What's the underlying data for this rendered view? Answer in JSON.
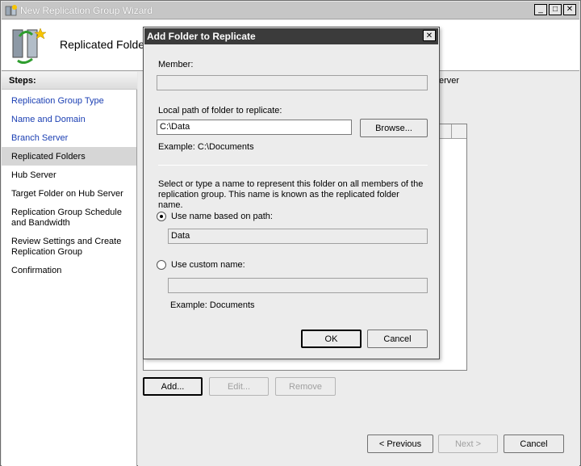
{
  "window": {
    "title": "New Replication Group Wizard",
    "controls": {
      "minimize": "_",
      "maximize": "□",
      "close": "✕"
    }
  },
  "header": {
    "title": "Replicated Folders"
  },
  "sidebar": {
    "heading": "Steps:",
    "items": [
      {
        "label": "Replication Group Type"
      },
      {
        "label": "Name and Domain"
      },
      {
        "label": "Branch Server"
      },
      {
        "label": "Replicated Folders"
      },
      {
        "label": "Hub Server"
      },
      {
        "label": "Target Folder on Hub Server"
      },
      {
        "label": "Replication Group Schedule and Bandwidth"
      },
      {
        "label": "Review Settings and Create Replication Group"
      },
      {
        "label": "Confirmation"
      }
    ]
  },
  "main": {
    "partial_text": "erver",
    "buttons": {
      "add": "Add...",
      "edit": "Edit...",
      "remove": "Remove"
    }
  },
  "footer": {
    "previous": "< Previous",
    "next": "Next >",
    "cancel": "Cancel"
  },
  "dialog": {
    "title": "Add Folder to Replicate",
    "close": "✕",
    "member_label": "Member:",
    "member_value": "",
    "local_path_label": "Local path of folder to replicate:",
    "local_path_value": "C:\\Data",
    "browse": "Browse...",
    "example_path": "Example: C:\\Documents",
    "description": "Select or type a name to represent this folder on all members of the replication group. This name is known as the replicated folder name.",
    "option_path": "Use name based on path:",
    "path_name_value": "Data",
    "option_custom": "Use custom name:",
    "custom_name_value": "",
    "example_name": "Example: Documents",
    "ok": "OK",
    "cancel": "Cancel"
  },
  "colors": {
    "link": "#1b3fb3",
    "dialog_title_bg": "#3b3b3b",
    "selected_step_bg": "#d6d6d6"
  }
}
